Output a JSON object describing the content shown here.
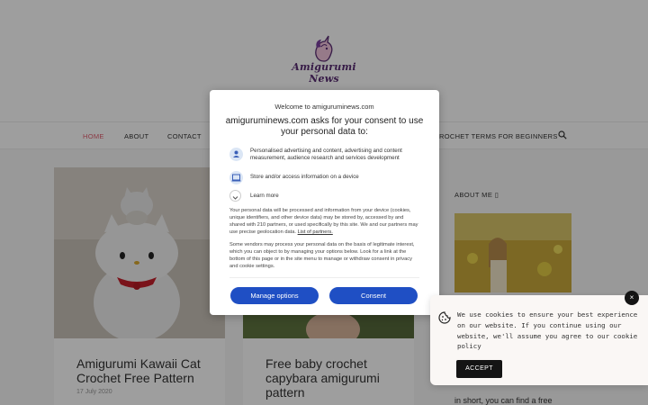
{
  "site": {
    "logo_text": "Amigurumi News"
  },
  "nav": {
    "items": [
      "HOME",
      "ABOUT",
      "CONTACT"
    ],
    "right_item": "ROCHET TERMS FOR BEGINNERS"
  },
  "posts": [
    {
      "title": "Amigurumi Kawaii Cat Crochet Free Pattern",
      "date": "17 July 2020"
    },
    {
      "title": "Free baby crochet capybara amigurumi pattern",
      "date": ""
    }
  ],
  "sidebar": {
    "about_heading": "ABOUT ME ▯",
    "text_fragment": "in short, you can find a free"
  },
  "consent": {
    "subtitle": "Welcome to amiguruminews.com",
    "title": "amiguruminews.com asks for your consent to use your personal data to:",
    "purposes": [
      {
        "icon": "person-icon",
        "text": "Personalised advertising and content, advertising and content measurement, audience research and services development"
      },
      {
        "icon": "device-icon",
        "text": "Store and/or access information on a device"
      }
    ],
    "learn_more": "Learn more",
    "paragraph1": "Your personal data will be processed and information from your device (cookies, unique identifiers, and other device data) may be stored by, accessed by and shared with 210 partners, or used specifically by this site. We and our partners may use precise geolocation data.",
    "partners_link": "List of partners.",
    "paragraph2": "Some vendors may process your personal data on the basis of legitimate interest, which you can object to by managing your options below. Look for a link at the bottom of this page or in the site menu to manage or withdraw consent in privacy and cookie settings.",
    "manage_label": "Manage options",
    "consent_label": "Consent",
    "button_color": "#1f4fc4"
  },
  "cookie_notice": {
    "text": "We use cookies to ensure your best experience on our website. If you continue using our website, we'll assume you agree to our cookie policy",
    "accept_label": "ACCEPT",
    "close_label": "×"
  }
}
